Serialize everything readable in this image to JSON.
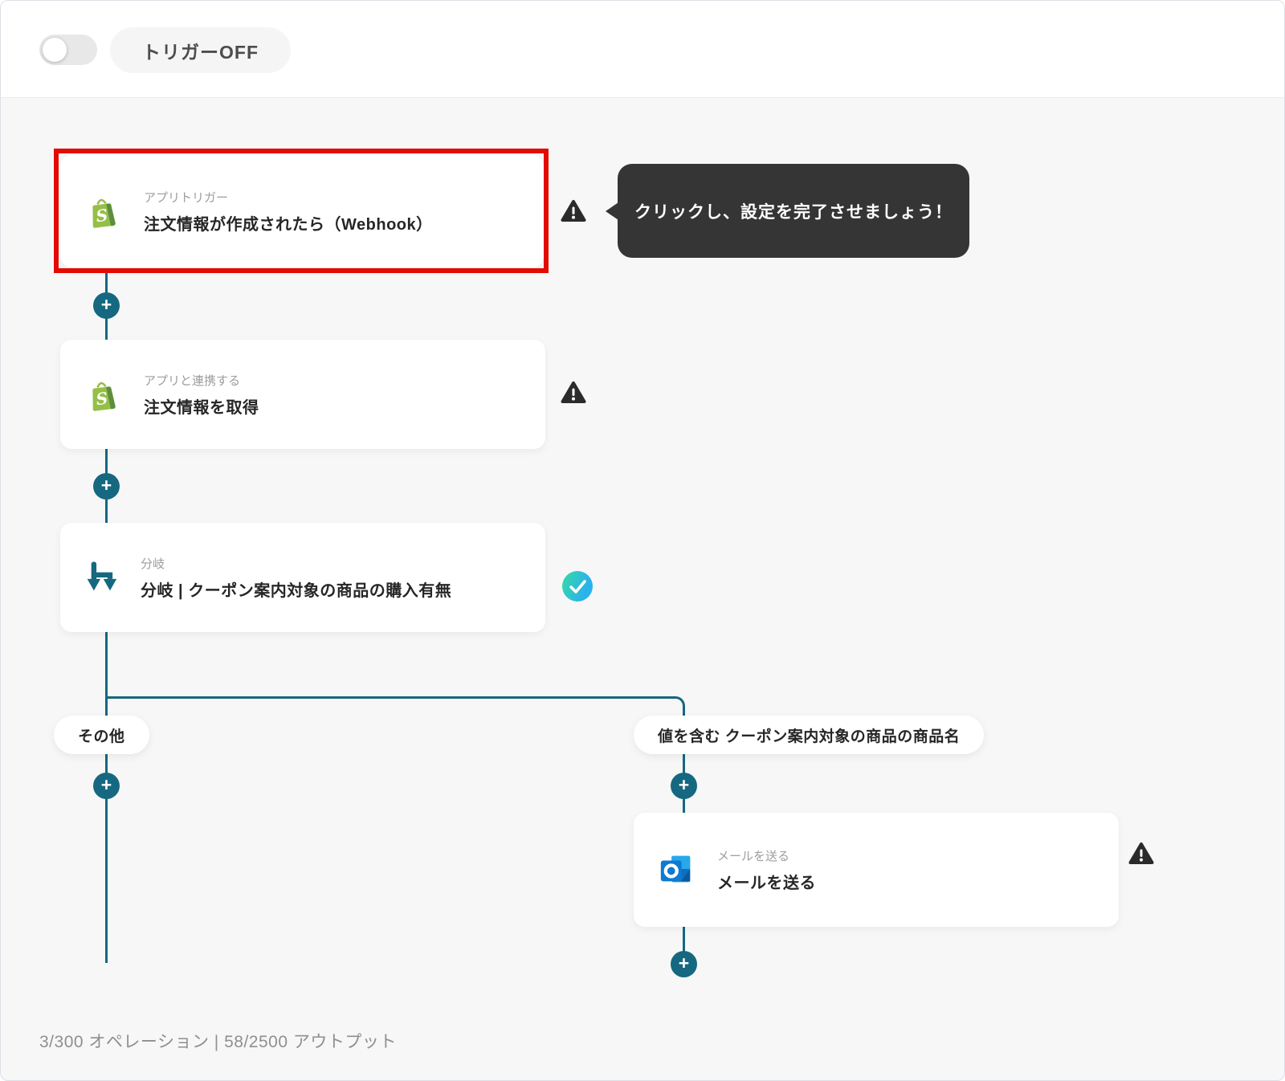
{
  "header": {
    "trigger_label": "トリガーOFF",
    "toggle_state": "off"
  },
  "tooltip": {
    "text": "クリックし、設定を完了させましょう！"
  },
  "nodes": [
    {
      "category": "アプリトリガー",
      "title": "注文情報が作成されたら（Webhook）",
      "app": "shopify",
      "status": "warning",
      "highlighted": true
    },
    {
      "category": "アプリと連携する",
      "title": "注文情報を取得",
      "app": "shopify",
      "status": "warning",
      "highlighted": false
    },
    {
      "category": "分岐",
      "title": "分岐 | クーポン案内対象の商品の購入有無",
      "app": "branch",
      "status": "ok",
      "highlighted": false
    },
    {
      "category": "メールを送る",
      "title": "メールを送る",
      "app": "outlook",
      "status": "warning",
      "highlighted": false
    }
  ],
  "branches": {
    "left_label": "その他",
    "right_label": "値を含む クーポン案内対象の商品の商品名"
  },
  "footer": {
    "usage": "3/300 オペレーション | 58/2500 アウトプット"
  },
  "icons": {
    "plus": "+"
  },
  "colors": {
    "accent_teal": "#156880",
    "highlight_red": "#e30b00",
    "tooltip_bg": "#353535",
    "check_gradient_start": "#35dba6",
    "check_gradient_end": "#2ab2ec",
    "shopify_green": "#95bf47",
    "shopify_green_dark": "#5e8e3e",
    "outlook_blue": "#0f7ad1",
    "background": "#f7f7f8"
  }
}
